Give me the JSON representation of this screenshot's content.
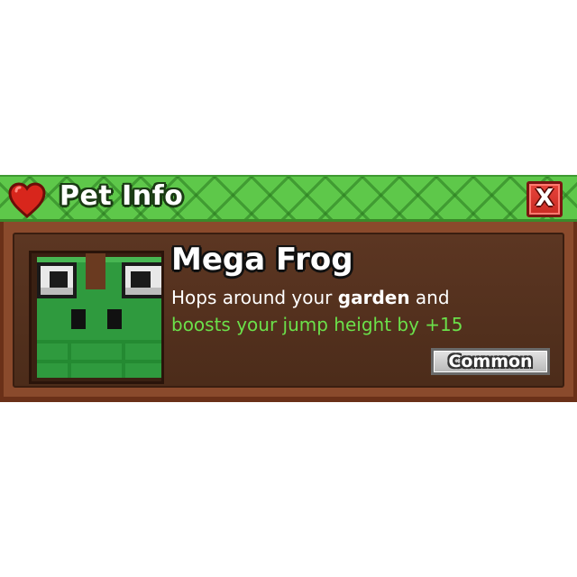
{
  "header": {
    "title": "Pet Info",
    "icon": "heart-icon",
    "close_label": "X"
  },
  "pet": {
    "name": "Mega Frog",
    "desc_line1_before": "Hops around your ",
    "desc_line1_bold": "garden",
    "desc_line1_after": " and",
    "desc_line2": "boosts your jump height by +15",
    "rarity": "Common",
    "portrait_icon": "frog-pet-icon"
  },
  "colors": {
    "header_green": "#5ec84a",
    "body_brown": "#8a4a2c",
    "inner_brown": "#5c3622",
    "bonus_green": "#6be04a",
    "close_red": "#e8453c"
  }
}
